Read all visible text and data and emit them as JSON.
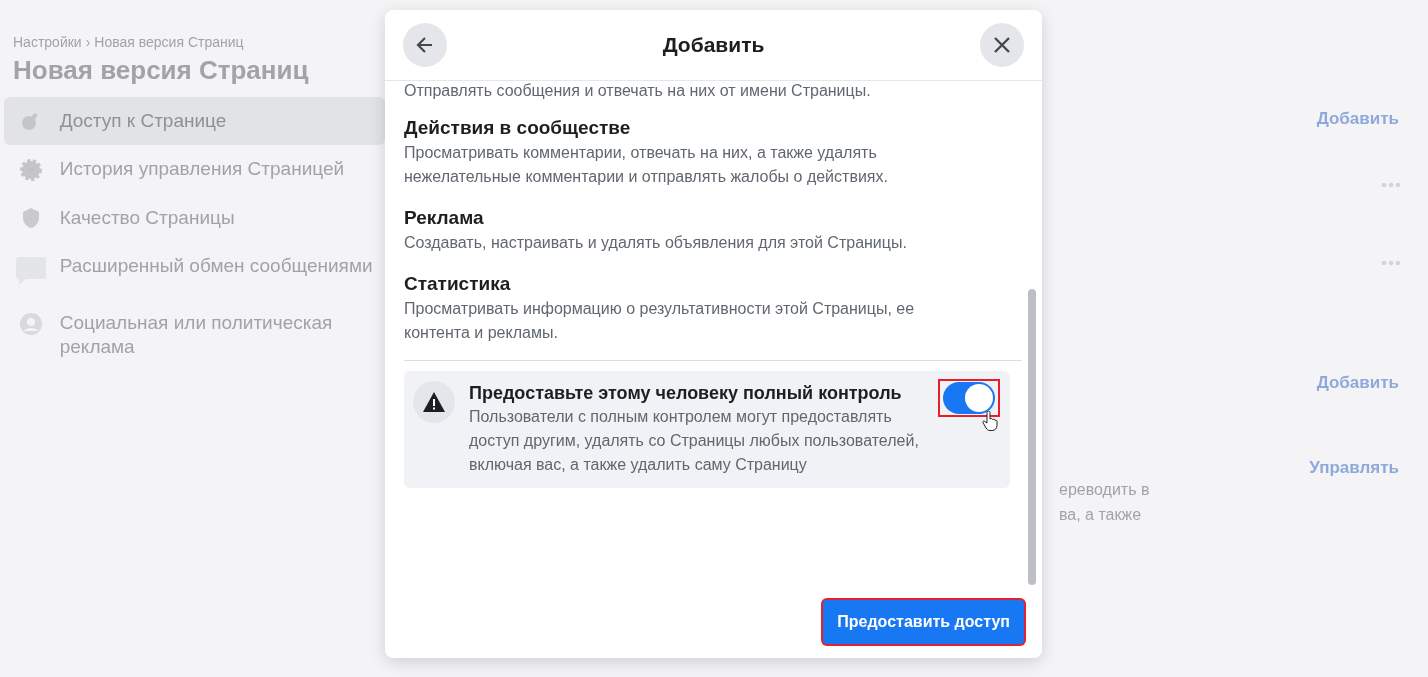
{
  "background": {
    "breadcrumb": {
      "items": [
        "Настройки",
        "Новая версия Страниц"
      ],
      "separator": "›"
    },
    "page_title": "Новая версия Страниц",
    "sidebar": {
      "items": [
        {
          "label": "Доступ к Странице",
          "selected": true
        },
        {
          "label": "История управления Страницей",
          "selected": false
        },
        {
          "label": "Качество Страницы",
          "selected": false
        },
        {
          "label": "Расширенный обмен сообщениями",
          "selected": false
        },
        {
          "label": "Социальная или политическая реклама",
          "selected": false
        }
      ]
    },
    "right_items": [
      {
        "kind": "link",
        "text": "Добавить"
      },
      {
        "kind": "more"
      },
      {
        "kind": "more"
      },
      {
        "kind": "link",
        "text": "Добавить"
      },
      {
        "kind": "link",
        "text": "Управлять",
        "lines": [
          "ереводить в",
          "ва, а также"
        ]
      }
    ]
  },
  "dialog": {
    "title": "Добавить",
    "permissions": [
      {
        "description": "Отправлять сообщения и отвечать на них от имени Страницы."
      },
      {
        "title": "Действия в сообществе",
        "description": "Просматривать комментарии, отвечать на них, а также удалять нежелательные комментарии и отправлять жалобы о действиях."
      },
      {
        "title": "Реклама",
        "description": "Создавать, настраивать и удалять объявления для этой Страницы."
      },
      {
        "title": "Статистика",
        "description": "Просматривать информацию о результативности этой Страницы, ее контента и рекламы."
      }
    ],
    "full_control": {
      "title": "Предоставьте этому человеку полный контроль",
      "description": "Пользователи с полным контролем могут предоставлять доступ другим, удалять со Страницы любых пользователей, включая вас, а также удалить саму Страницу",
      "on": true,
      "highlighted": true
    },
    "primary_button": {
      "label": "Предоставить доступ",
      "highlighted": true
    }
  }
}
